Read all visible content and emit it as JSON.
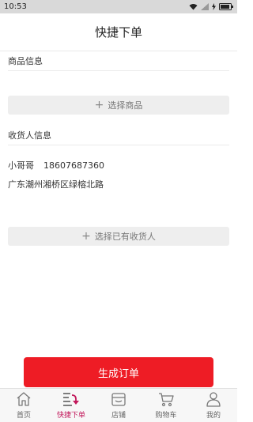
{
  "status_bar": {
    "time": "10:53"
  },
  "header": {
    "title": "快捷下单"
  },
  "product_section": {
    "title": "商品信息",
    "select_label": "选择商品"
  },
  "recipient_section": {
    "title": "收货人信息",
    "name": "小哥哥",
    "phone": "18607687360",
    "address": "广东潮州湘桥区绿榕北路",
    "select_label": "选择已有收货人"
  },
  "submit": {
    "label": "生成订单"
  },
  "tabs": [
    {
      "label": "首页",
      "icon": "home-icon",
      "active": false
    },
    {
      "label": "快捷下单",
      "icon": "quick-order-icon",
      "active": true
    },
    {
      "label": "店铺",
      "icon": "store-icon",
      "active": false
    },
    {
      "label": "购物车",
      "icon": "cart-icon",
      "active": false
    },
    {
      "label": "我的",
      "icon": "user-icon",
      "active": false
    }
  ],
  "colors": {
    "accent": "#ee1c25",
    "tab_active": "#c2185b"
  }
}
